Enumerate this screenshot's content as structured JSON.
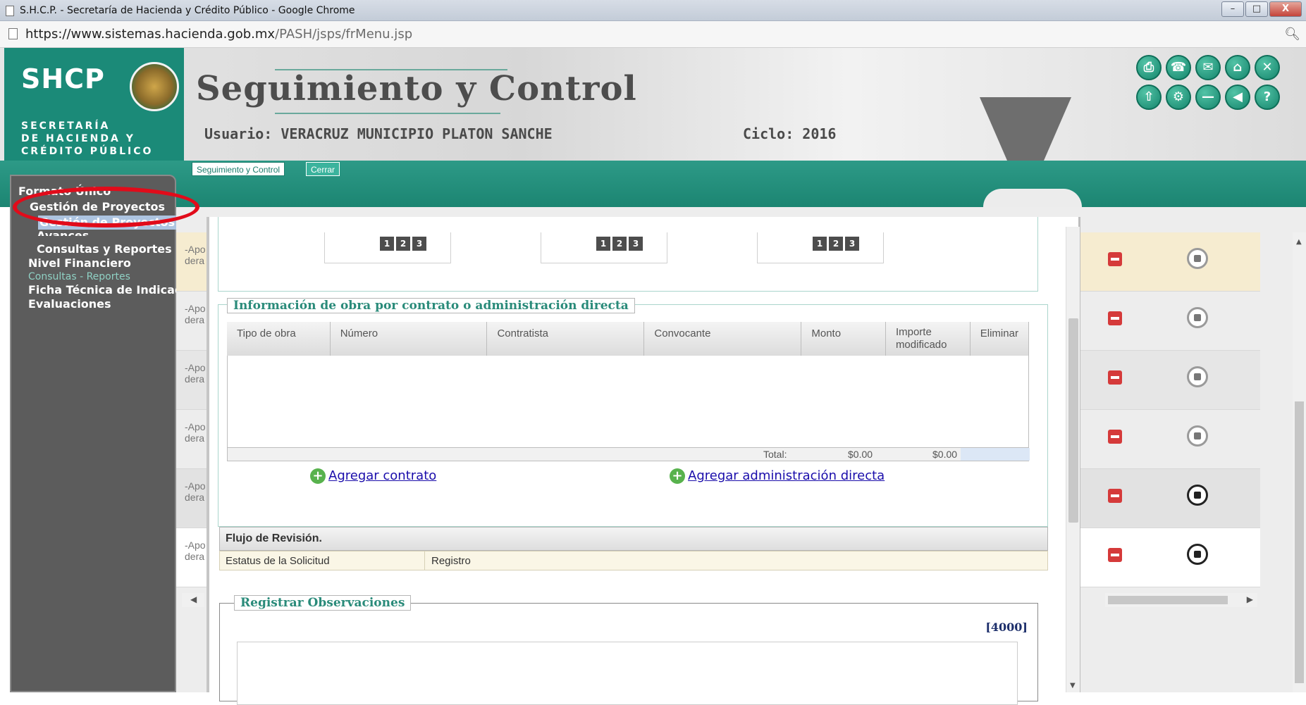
{
  "browser": {
    "window_title": "S.H.C.P. - Secretaría de Hacienda y Crédito Público - Google Chrome",
    "url_host": "https://www.sistemas.hacienda.gob.mx",
    "url_path": "/PASH/jsps/frMenu.jsp",
    "window_buttons": [
      "–",
      "□",
      "X"
    ]
  },
  "header": {
    "logo_text": "SHCP",
    "secretaria_lines": [
      "SECRETARÍA",
      "DE HACIENDA Y",
      "CRÉDITO PÚBLICO"
    ],
    "system_title": "Seguimiento y Control",
    "usuario": "Usuario: VERACRUZ MUNICIPIO PLATON SANCHE",
    "ciclo": "Ciclo: 2016",
    "toolbar_icons": [
      "print-icon",
      "phone-icon",
      "mail-icon",
      "home-icon",
      "close-icon",
      "export-icon",
      "settings-icon",
      "minus-icon",
      "back-icon",
      "help-icon"
    ]
  },
  "tabs": {
    "tab1": "Seguimiento y Control",
    "tab2": "Cerrar"
  },
  "nav": {
    "formato_unico": "Formato Único",
    "gestion_proyectos": "Gestión de Proyectos",
    "gestion_proyectos_sub": "Gestión de Proyectos",
    "avances": "Avances",
    "consultas_reportes": "Consultas y Reportes",
    "nivel_financiero": "Nivel Financiero",
    "consultas_sub": "Consultas - Reportes",
    "ficha_tecnica": "Ficha Técnica de Indicadores",
    "evaluaciones": "Evaluaciones"
  },
  "background_rows": {
    "truncated_line1": "-Apo",
    "truncated_line2": "dera"
  },
  "pagers": [
    [
      "1",
      "2",
      "3"
    ],
    [
      "1",
      "2",
      "3"
    ],
    [
      "1",
      "2",
      "3"
    ]
  ],
  "obra": {
    "legend": "Información de obra por contrato o administración directa",
    "columns": [
      "Tipo de obra",
      "Número",
      "Contratista",
      "Convocante",
      "Monto",
      "Importe modificado",
      "Eliminar"
    ],
    "total_label": "Total:",
    "total_monto": "$0.00",
    "total_importe": "$0.00",
    "add_contrato": "Agregar contrato",
    "add_admin": "Agregar administración directa"
  },
  "flujo": {
    "title": "Flujo de Revisión.",
    "estatus_label": "Estatus de la Solicitud",
    "estatus_value": "Registro"
  },
  "observaciones": {
    "legend": "Registrar Observaciones",
    "char_count": "[4000]"
  },
  "colors": {
    "brand_green": "#1b8a78",
    "highlight_red": "#e10b1a"
  }
}
